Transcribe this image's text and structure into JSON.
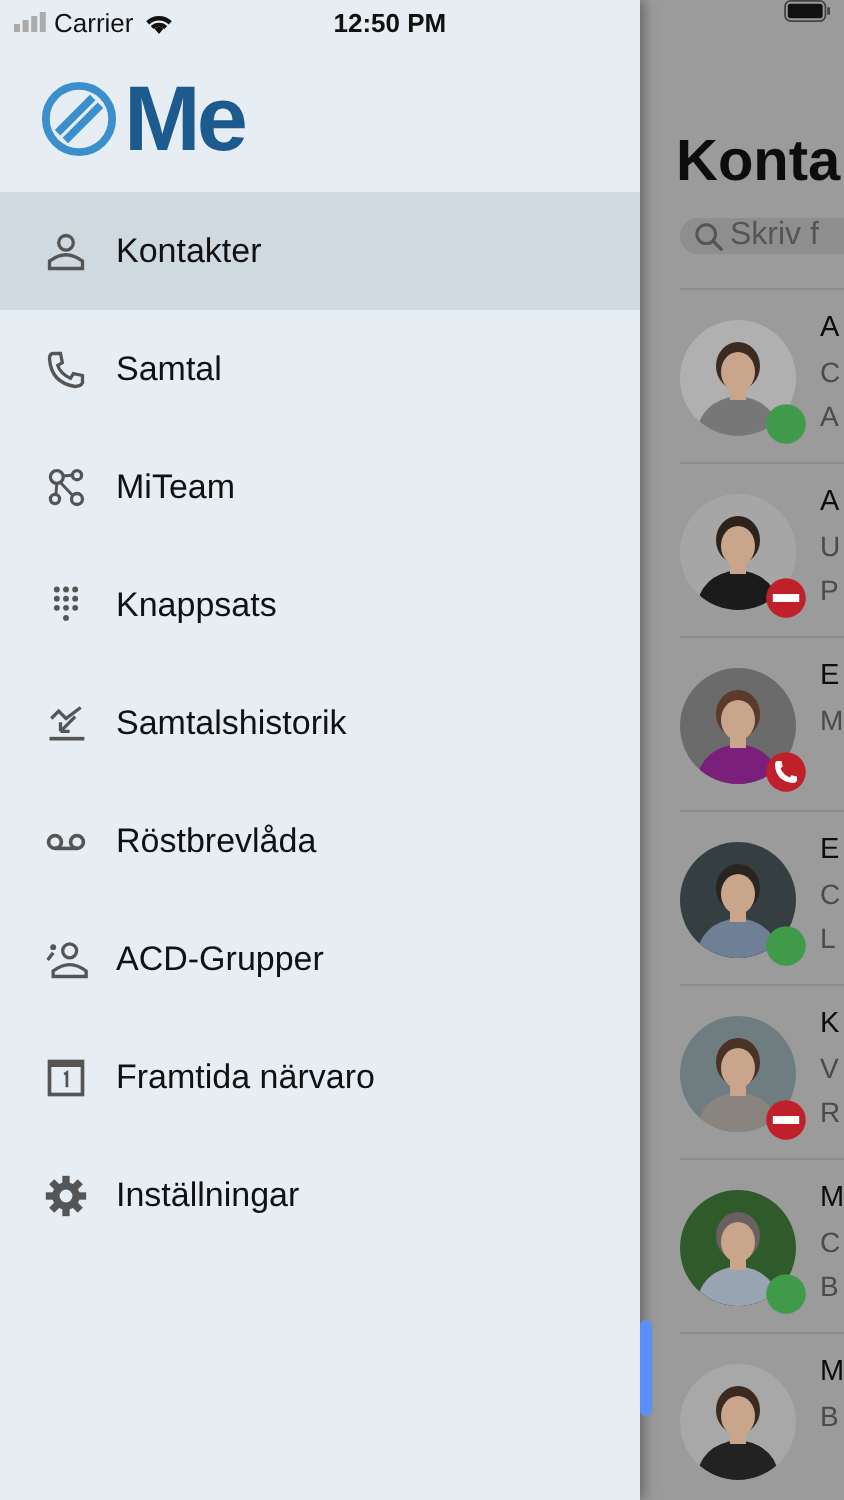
{
  "status_bar": {
    "carrier": "Carrier",
    "time": "12:50 PM"
  },
  "logo": {
    "text": "Me"
  },
  "menu": [
    {
      "label": "Kontakter",
      "selected": true
    },
    {
      "label": "Samtal",
      "selected": false
    },
    {
      "label": "MiTeam",
      "selected": false
    },
    {
      "label": "Knappsats",
      "selected": false
    },
    {
      "label": "Samtalshistorik",
      "selected": false
    },
    {
      "label": "Röstbrevlåda",
      "selected": false
    },
    {
      "label": "ACD-Grupper",
      "selected": false
    },
    {
      "label": "Framtida närvaro",
      "selected": false
    },
    {
      "label": "Inställningar",
      "selected": false
    }
  ],
  "contacts_panel": {
    "title": "Konta",
    "search": {
      "placeholder": "Skriv f"
    },
    "contacts": [
      {
        "name": "A",
        "line_2": "C",
        "line_3": "A",
        "kind": "dot",
        "color": "#3f9a49"
      },
      {
        "name": "A",
        "line_2": "U",
        "line_3": "P",
        "kind": "minus",
        "color": "#c0202a"
      },
      {
        "name": "E",
        "line_2": "M",
        "kind": "phone",
        "color": "#c0202a"
      },
      {
        "name": "E",
        "line_2": "C",
        "line_3": "L",
        "kind": "dot",
        "color": "#3f9a49"
      },
      {
        "name": "K",
        "line_2": "V",
        "line_3": "R",
        "kind": "minus",
        "color": "#c0202a"
      },
      {
        "name": "M",
        "line_2": "C",
        "line_3": "B",
        "kind": "dot",
        "color": "#3f9a49"
      },
      {
        "name": "M",
        "line_2": "B"
      }
    ]
  }
}
